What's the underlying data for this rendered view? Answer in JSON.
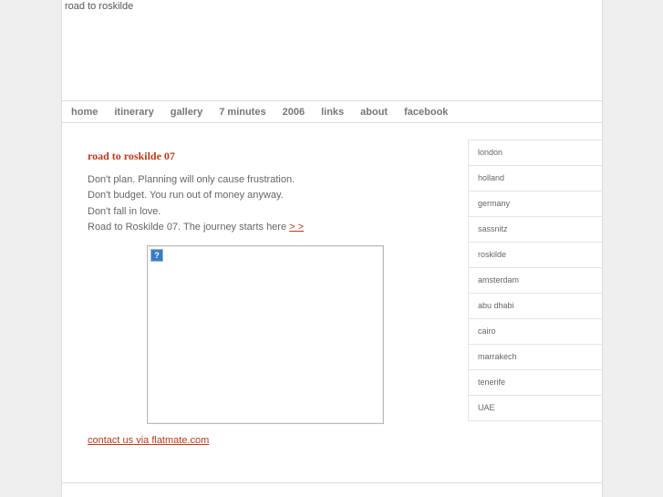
{
  "site_title": "road to roskilde",
  "nav": [
    "home",
    "itinerary",
    "gallery",
    "7 minutes",
    "2006",
    "links",
    "about",
    "facebook"
  ],
  "heading": "road to roskilde 07",
  "intro": {
    "line1": "Don't plan. Planning will only cause frustration.",
    "line2": "Don't budget. You run out of money anyway.",
    "line3": "Don't fall in love.",
    "line4": "Road to Roskilde 07. The journey starts here ",
    "link": "> >"
  },
  "broken_image_icon": "?",
  "contact": "contact us via flatmate.com",
  "sidebar": [
    "london",
    "holland",
    "germany",
    "sassnitz",
    "roskilde",
    "amsterdam",
    "abu dhabi",
    "cairo",
    "marrakech",
    "tenerife",
    "UAE"
  ]
}
